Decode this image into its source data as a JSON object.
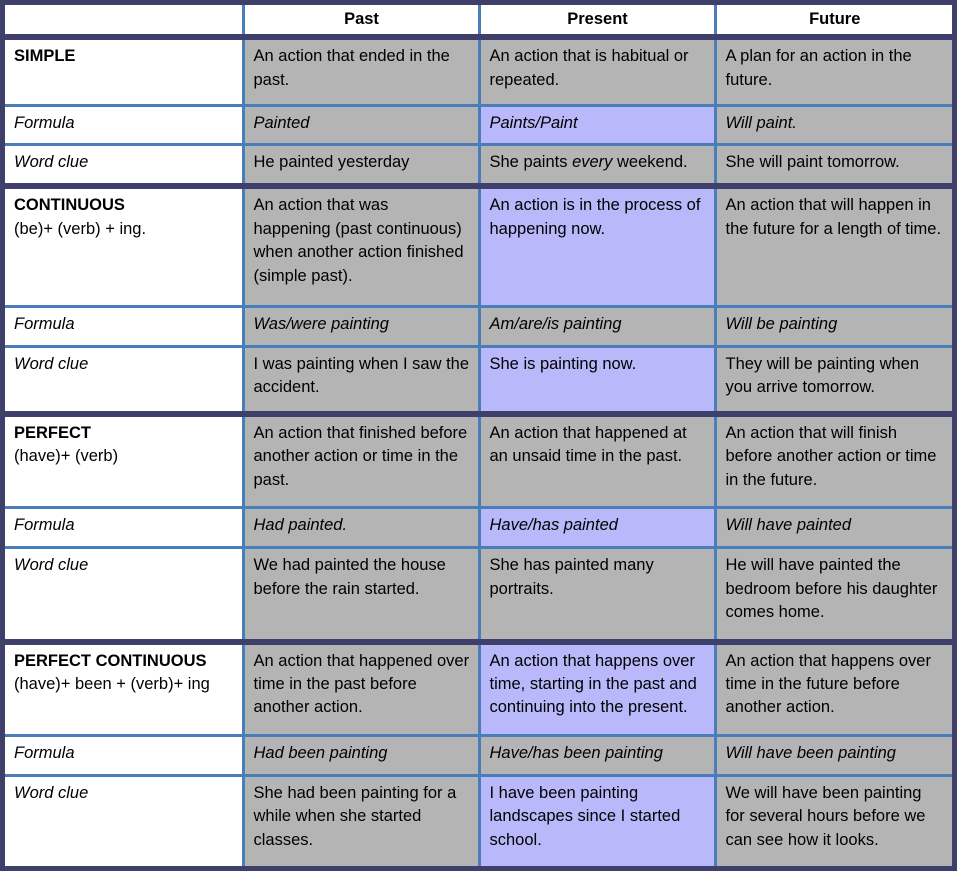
{
  "table": {
    "columns": {
      "corner": "",
      "past": "Past",
      "present": "Present",
      "future": "Future"
    },
    "row_labels": {
      "formula": "Formula",
      "word_clue": "Word clue"
    },
    "sections": [
      {
        "id": "simple",
        "title": "SIMPLE",
        "subtitle": "",
        "description": {
          "past": "An action that ended in the past.",
          "present": "An action that is habitual or repeated.",
          "future": "A plan for an action in the future."
        },
        "formula": {
          "past": "Painted",
          "present": "Paints/Paint",
          "future": "Will paint."
        },
        "word_clue": {
          "past": "He painted yesterday",
          "present_pre": "She paints ",
          "present_em": "every",
          "present_post": " weekend.",
          "future": "She will paint tomorrow."
        }
      },
      {
        "id": "continuous",
        "title": "CONTINUOUS",
        "subtitle": "(be)+ (verb) + ing.",
        "description": {
          "past": "An action that was happening (past continuous) when another action finished (simple past).",
          "present": "An action is in the process of happening now.",
          "future": "An action that will happen in the future for a length of time."
        },
        "formula": {
          "past": "Was/were painting",
          "present": "Am/are/is painting",
          "future": "Will be painting"
        },
        "word_clue": {
          "past": "I was painting when I saw the accident.",
          "present": "She is painting now.",
          "future": "They will be painting when you arrive tomorrow."
        }
      },
      {
        "id": "perfect",
        "title": "PERFECT",
        "subtitle": "(have)+ (verb)",
        "description": {
          "past": "An action that finished before another action or time in the past.",
          "present": "An action that happened at an unsaid time in the past.",
          "future": "An action that will finish before another action or time in the future."
        },
        "formula": {
          "past": "Had painted.",
          "present": "Have/has painted",
          "future": "Will have painted"
        },
        "word_clue": {
          "past": "We had painted the house before the rain started.",
          "present": "She has painted many portraits.",
          "future": "He will have painted the bedroom before his daughter comes home."
        }
      },
      {
        "id": "perfect-continuous",
        "title": "PERFECT CONTINUOUS",
        "subtitle": "(have)+ been + (verb)+ ing",
        "description": {
          "past": "An action that happened over time in the past before another action.",
          "present": "An action that happens over time, starting in the past and continuing into the present.",
          "future": "An action that happens over time in the future before another action."
        },
        "formula": {
          "past": "Had been painting",
          "present": "Have/has been painting",
          "future": "Will have been painting"
        },
        "word_clue": {
          "past": "She had been painting for a while when she started classes.",
          "present": "I have been painting landscapes since I started school.",
          "future": "We will have been painting for several hours before we can see how it looks."
        }
      }
    ]
  },
  "colors": {
    "outer_border": "#3f3f6b",
    "inner_border": "#4a7ebb",
    "cell_gray": "#b4b4b4",
    "cell_lavender": "#b8b8fb",
    "cell_white": "#ffffff"
  }
}
